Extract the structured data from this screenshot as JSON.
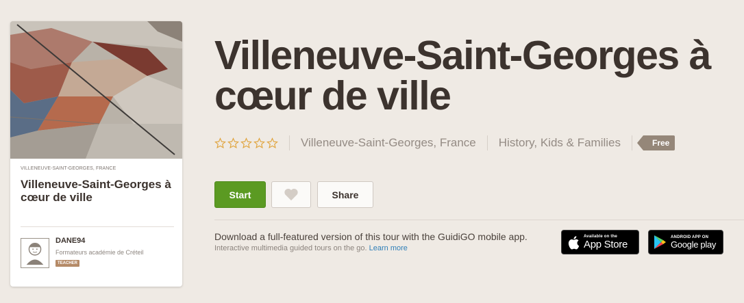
{
  "card": {
    "location": "VILLENEUVE-SAINT-GEORGES, FRANCE",
    "title": "Villeneuve-Saint-Georges à cœur de ville",
    "author": {
      "name": "DANE94",
      "organization": "Formateurs académie de Créteil",
      "badge": "TEACHER"
    }
  },
  "tour": {
    "title": "Villeneuve-Saint-Georges à cœur de ville",
    "rating": 0,
    "rating_max": 5,
    "location": "Villeneuve-Saint-Georges, France",
    "categories": "History, Kids & Families",
    "price": "Free"
  },
  "actions": {
    "start_label": "Start",
    "favorite_icon": "heart-icon",
    "share_label": "Share"
  },
  "promo": {
    "main_text": "Download a full-featured version of this tour with the GuidiGO mobile app.",
    "sub_text": "Interactive multimedia guided tours on the go.",
    "learn_more": "Learn more",
    "app_store": {
      "small": "Available on the",
      "big": "App Store"
    },
    "google_play": {
      "small": "ANDROID APP ON",
      "big": "Google play"
    }
  },
  "colors": {
    "background": "#efeae4",
    "start_button": "#5b9a22",
    "star_outline": "#e0a33a",
    "price_tag": "#958779",
    "teacher_badge": "#b58a67",
    "link": "#2f7fb8"
  }
}
